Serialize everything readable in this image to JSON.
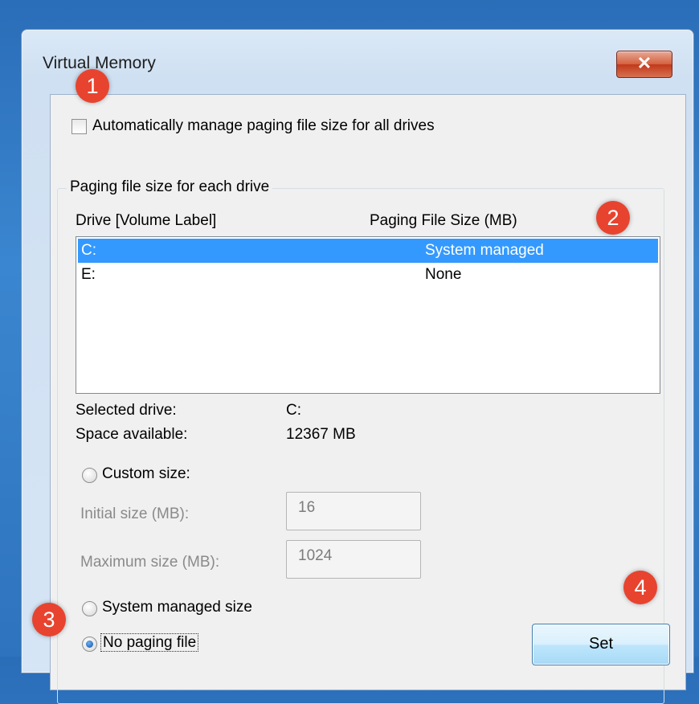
{
  "window": {
    "title": "Virtual Memory",
    "close_glyph": "✕"
  },
  "auto_manage": {
    "label": "Automatically manage paging file size for all drives",
    "checked": false
  },
  "group": {
    "title": "Paging file size for each drive",
    "col_drive": "Drive  [Volume Label]",
    "col_size": "Paging File Size (MB)",
    "drives": [
      {
        "drive": "C:",
        "size": "System managed",
        "selected": true
      },
      {
        "drive": "E:",
        "size": "None",
        "selected": false
      }
    ]
  },
  "info": {
    "selected_label": "Selected drive:",
    "selected_value": "C:",
    "space_label": "Space available:",
    "space_value": "12367 MB"
  },
  "options": {
    "custom_label": "Custom size:",
    "initial_label": "Initial size (MB):",
    "initial_value": "16",
    "maximum_label": "Maximum size (MB):",
    "maximum_value": "1024",
    "system_label": "System managed size",
    "none_label": "No paging file",
    "selected": "none"
  },
  "set_button": "Set",
  "badges": [
    "1",
    "2",
    "3",
    "4"
  ],
  "colors": {
    "selection": "#3399ff",
    "badge": "#e8432f",
    "close": "#c2381c"
  }
}
